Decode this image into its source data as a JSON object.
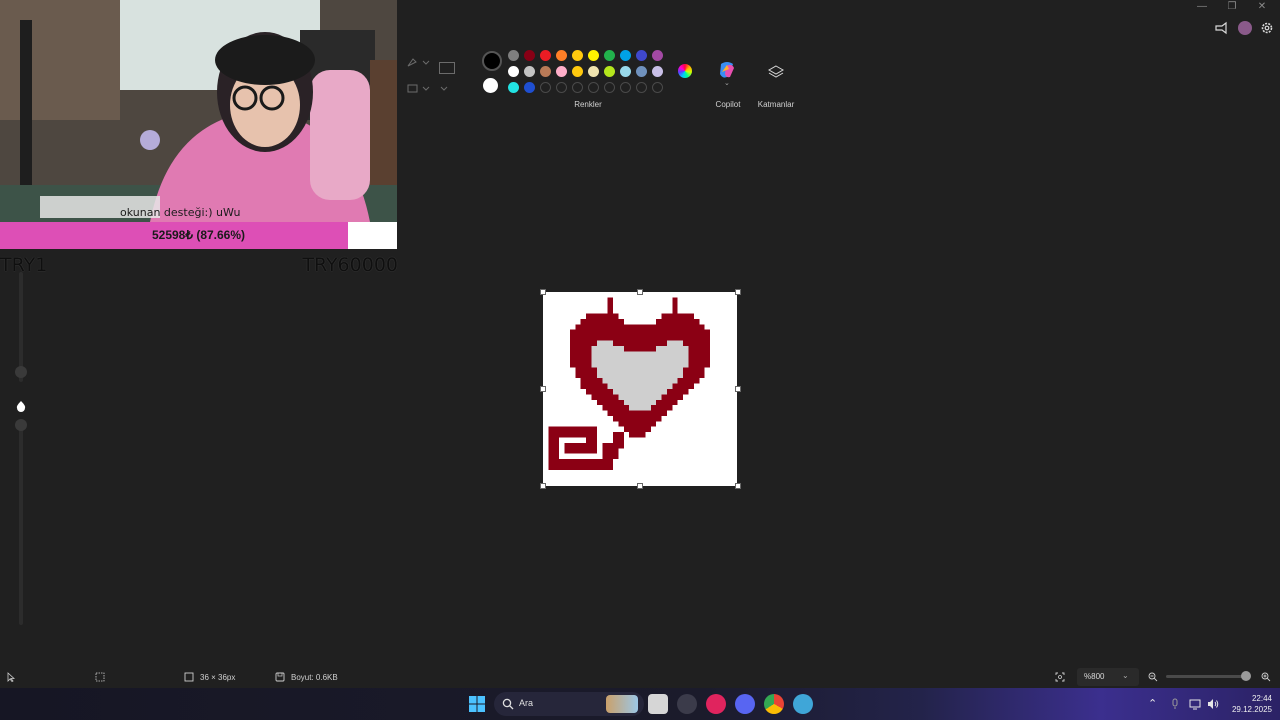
{
  "stream": {
    "webcam_caption": "okunan desteği:) uWu",
    "goal_text": "52598₺ (87.66%)",
    "goal_progress": 0.8766,
    "goal_min": "TRY1",
    "goal_max": "TRY60000",
    "goal_color": "#dd4fb6"
  },
  "ribbon": {
    "colors_label": "Renkler",
    "copilot_label": "Copilot",
    "layers_label": "Katmanlar",
    "primary_color": "#000000",
    "secondary_color": "#ffffff",
    "palette_row1": [
      "#000000",
      "#7f7f7f",
      "#880015",
      "#ed1c24",
      "#ff7f27",
      "#ffc90e",
      "#fff200",
      "#22b14c",
      "#00a2e8",
      "#3f48cc",
      "#a349a4"
    ],
    "palette_row2": [
      "#ffffff",
      "#c3c3c3",
      "#b97a57",
      "#ffaec9",
      "#ffc90e",
      "#efe4b0",
      "#b5e61d",
      "#99d9ea",
      "#7092be",
      "#c8bfe7"
    ],
    "palette_row3": [
      "#22e3e3",
      "#1f4fd1"
    ]
  },
  "canvas": {
    "accent_color": "#8b0014",
    "fill_color": "#cfcfcf"
  },
  "statusbar": {
    "canvas_size": "36 × 36px",
    "file_size": "Boyut: 0.6KB",
    "zoom": "%800"
  },
  "taskbar": {
    "search_placeholder": "Ara",
    "time": "22:44",
    "date": "29.12.2025"
  }
}
